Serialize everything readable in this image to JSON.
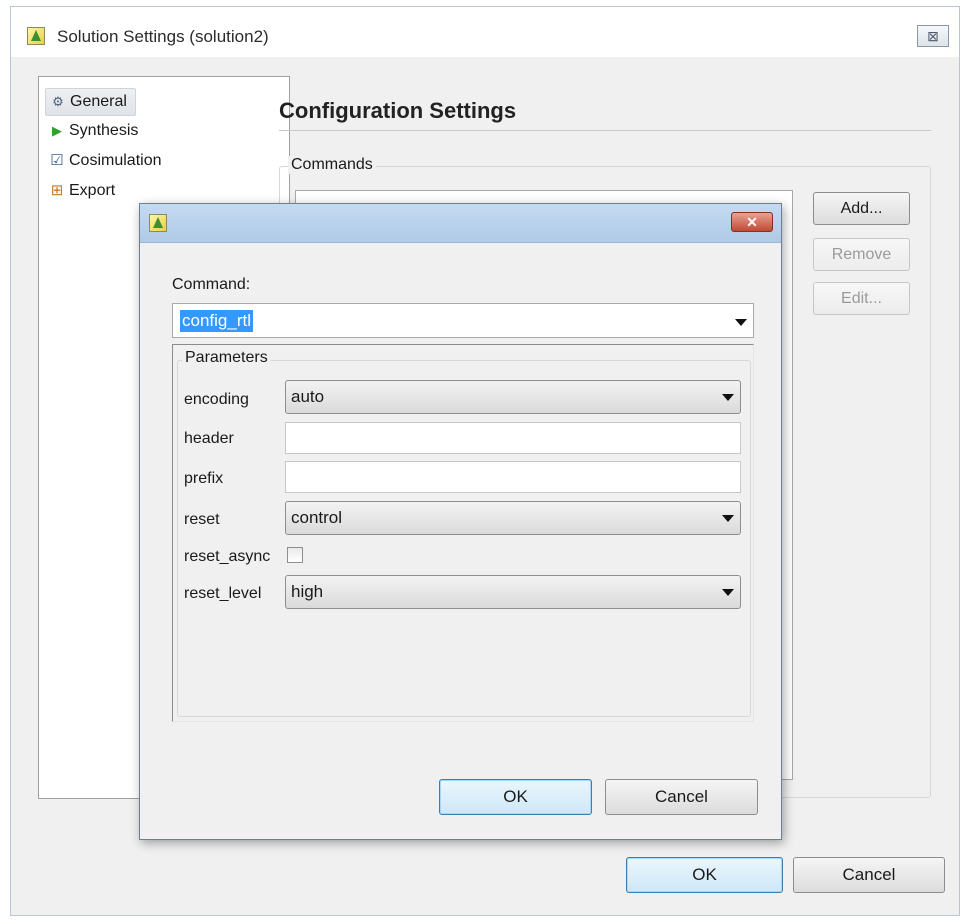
{
  "window": {
    "title": "Solution Settings (solution2)",
    "close_glyph": "⊠",
    "icon": "app-logo-icon"
  },
  "nav": {
    "items": [
      {
        "label": "General",
        "icon": "gear-icon",
        "glyph": "⚙"
      },
      {
        "label": "Synthesis",
        "icon": "play-icon",
        "glyph": "▶"
      },
      {
        "label": "Cosimulation",
        "icon": "checkbox-icon",
        "glyph": "☑"
      },
      {
        "label": "Export",
        "icon": "export-icon",
        "glyph": "⊞"
      }
    ]
  },
  "config": {
    "title": "Configuration Settings",
    "commands_legend": "Commands",
    "add_label": "Add...",
    "remove_label": "Remove",
    "edit_label": "Edit..."
  },
  "footer": {
    "ok_label": "OK",
    "cancel_label": "Cancel"
  },
  "dialog": {
    "command_label": "Command:",
    "command_value": "config_rtl",
    "close_glyph": "✕",
    "params_legend": "Parameters",
    "params": {
      "encoding": {
        "label": "encoding",
        "value": "auto"
      },
      "header": {
        "label": "header",
        "value": ""
      },
      "prefix": {
        "label": "prefix",
        "value": ""
      },
      "reset": {
        "label": "reset",
        "value": "control"
      },
      "reset_async": {
        "label": "reset_async",
        "checked": false
      },
      "reset_level": {
        "label": "reset_level",
        "value": "high"
      }
    },
    "ok_label": "OK",
    "cancel_label": "Cancel"
  },
  "colors": {
    "selection": "#3399ff",
    "synthesis_green": "#2fa12f",
    "export_orange": "#c8771d",
    "dialog_close_red": "#c24a35"
  }
}
